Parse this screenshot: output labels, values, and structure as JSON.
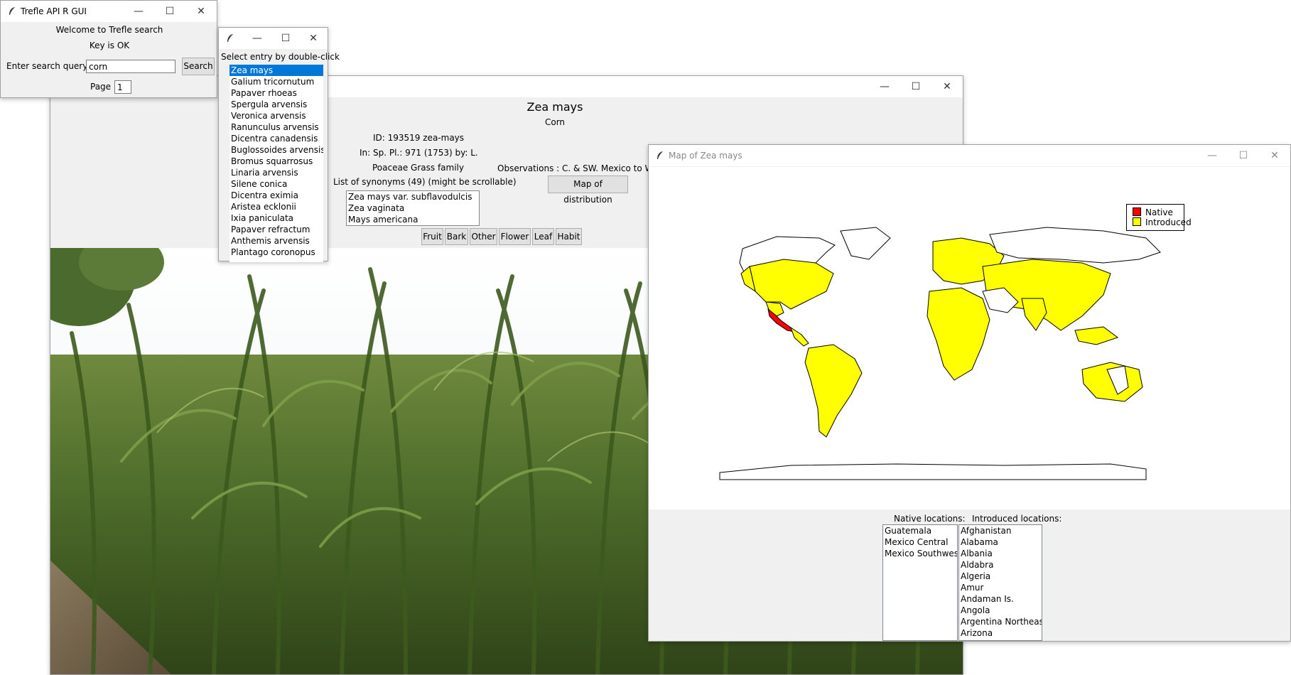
{
  "search_window": {
    "title": "Trefle API R GUI",
    "welcome": "Welcome to Trefle search",
    "key_status": "Key is OK",
    "query_label": "Enter search query:",
    "query_value": "corn",
    "search_button": "Search",
    "page_label": "Page :",
    "page_value": "1"
  },
  "results_window": {
    "instruction": "Select entry by double-click",
    "selected_index": 0,
    "entries": [
      "Zea mays",
      "Galium tricornutum",
      "Papaver rhoeas",
      "Spergula arvensis",
      "Veronica arvensis",
      "Ranunculus arvensis",
      "Dicentra canadensis",
      "Buglossoides arvensis",
      "Bromus squarrosus",
      "Linaria arvensis",
      "Silene conica",
      "Dicentra eximia",
      "Aristea ecklonii",
      "Ixia paniculata",
      "Papaver refractum",
      "Anthemis arvensis",
      "Plantago coronopus"
    ]
  },
  "detail_window": {
    "scientific_name": "Zea mays",
    "common_name": "Corn",
    "id_line": "ID:  193519  zea-mays",
    "publication_line": "In:  Sp. Pl.: 971 (1753)  by:  L.",
    "family_line": "Poaceae  Grass family",
    "observations": "Observations : C. & SW. Mexico to W. Gu",
    "synonyms_label": "List of synonyms (49) (might be scrollable)",
    "synonyms": [
      "Zea mays var. subflavodulcis",
      "Zea vaginata",
      "Mays americana"
    ],
    "map_button": "Map of distribution",
    "image_buttons": [
      "Fruit",
      "Bark",
      "Other",
      "Flower",
      "Leaf",
      "Habit"
    ]
  },
  "map_window": {
    "title": "Map of Zea mays",
    "legend": [
      {
        "label": "Native",
        "color": "#ff0000"
      },
      {
        "label": "Introduced",
        "color": "#ffff00"
      }
    ],
    "native_label": "Native locations:",
    "native_locations": [
      "Guatemala",
      "Mexico Central",
      "Mexico Southwest"
    ],
    "introduced_label": "Introduced locations:",
    "introduced_locations": [
      "Afghanistan",
      "Alabama",
      "Albania",
      "Aldabra",
      "Algeria",
      "Amur",
      "Andaman Is.",
      "Angola",
      "Argentina Northeast",
      "Arizona"
    ]
  },
  "icons": {
    "app": "feather-icon",
    "minimize": "minimize-icon",
    "maximize": "maximize-icon",
    "close": "close-icon"
  }
}
